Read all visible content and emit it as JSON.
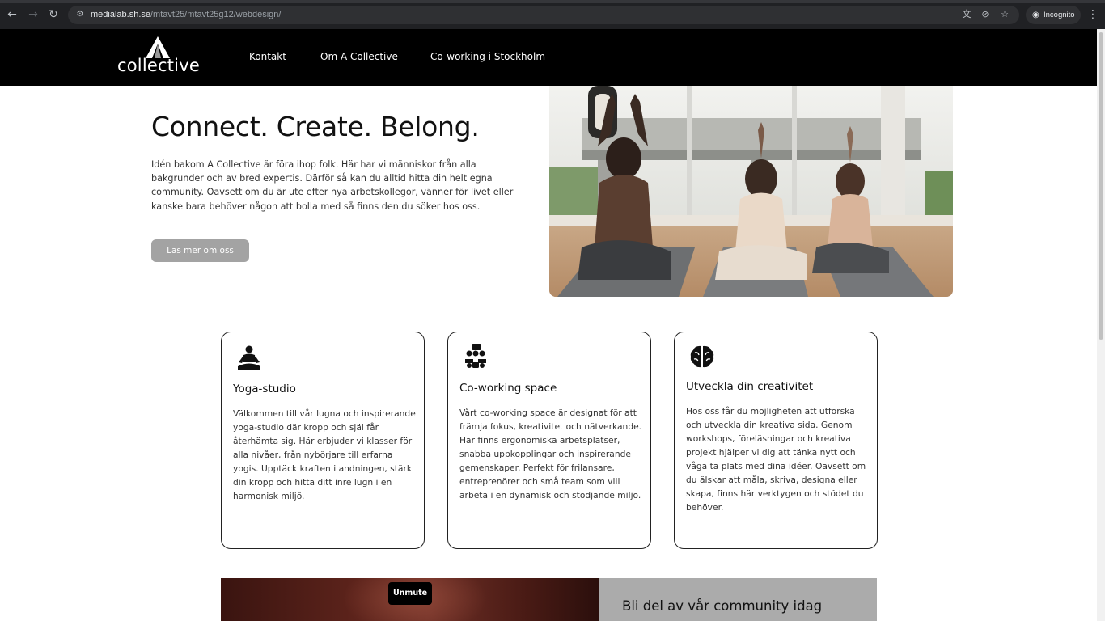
{
  "browser": {
    "url_host": "medialab.sh.se",
    "url_path": "/mtavt25/mtavt25g12/webdesign/",
    "incognito_label": "Incognito",
    "icons": [
      "back-arrow-icon",
      "forward-arrow-icon",
      "reload-icon",
      "site-info-icon",
      "translate-icon",
      "eye-off-icon",
      "star-icon",
      "incognito-icon",
      "kebab-menu-icon"
    ]
  },
  "header": {
    "logo_text": "collective",
    "nav": [
      "Kontakt",
      "Om A Collective",
      "Co-working i Stockholm"
    ]
  },
  "hero": {
    "title": "Connect. Create. Belong.",
    "text": "Idén bakom A Collective är föra ihop folk. Här har vi människor från alla bakgrunder och av bred expertis. Därför så kan du alltid hitta din helt egna community. Oavsett om du är ute efter nya arbetskollegor, vänner för livet eller kanske bara behöver någon att bolla med så finns den du söker hos oss.",
    "button_label": "Läs mer om oss"
  },
  "cards": [
    {
      "icon": "meditation-icon",
      "title": "Yoga-studio",
      "text": "Välkommen till vår lugna och inspirerande yoga-studio där kropp och själ får återhämta sig. Här erbjuder vi klasser för alla nivåer, från nybörjare till erfarna yogis. Upptäck kraften i andningen, stärk din kropp och hitta ditt inre lugn i en harmonisk miljö."
    },
    {
      "icon": "people-group-icon",
      "title": "Co-working space",
      "text": "Vårt co-working space är designat för att främja fokus, kreativitet och nätverkande. Här finns ergonomiska arbetsplatser, snabba uppkopplingar och inspirerande gemenskaper. Perfekt för frilansare, entreprenörer och små team som vill arbeta i en dynamisk och stödjande miljö."
    },
    {
      "icon": "brain-icon",
      "title": "Utveckla din creativitet",
      "text": "Hos oss får du möjligheten att utforska och utveckla din kreativa sida. Genom workshops, föreläsningar och kreativa projekt hjälper vi dig att tänka nytt och våga ta plats med dina idéer. Oavsett om du älskar att måla, skriva, designa eller skapa, finns här verktygen och stödet du behöver."
    }
  ],
  "community": {
    "unmute_label": "Unmute",
    "title": "Bli del av vår community idag"
  },
  "colors": {
    "header_bg": "#000000",
    "button_bg": "#a3a3a3",
    "panel_bg": "#ababab",
    "text": "#111111"
  }
}
